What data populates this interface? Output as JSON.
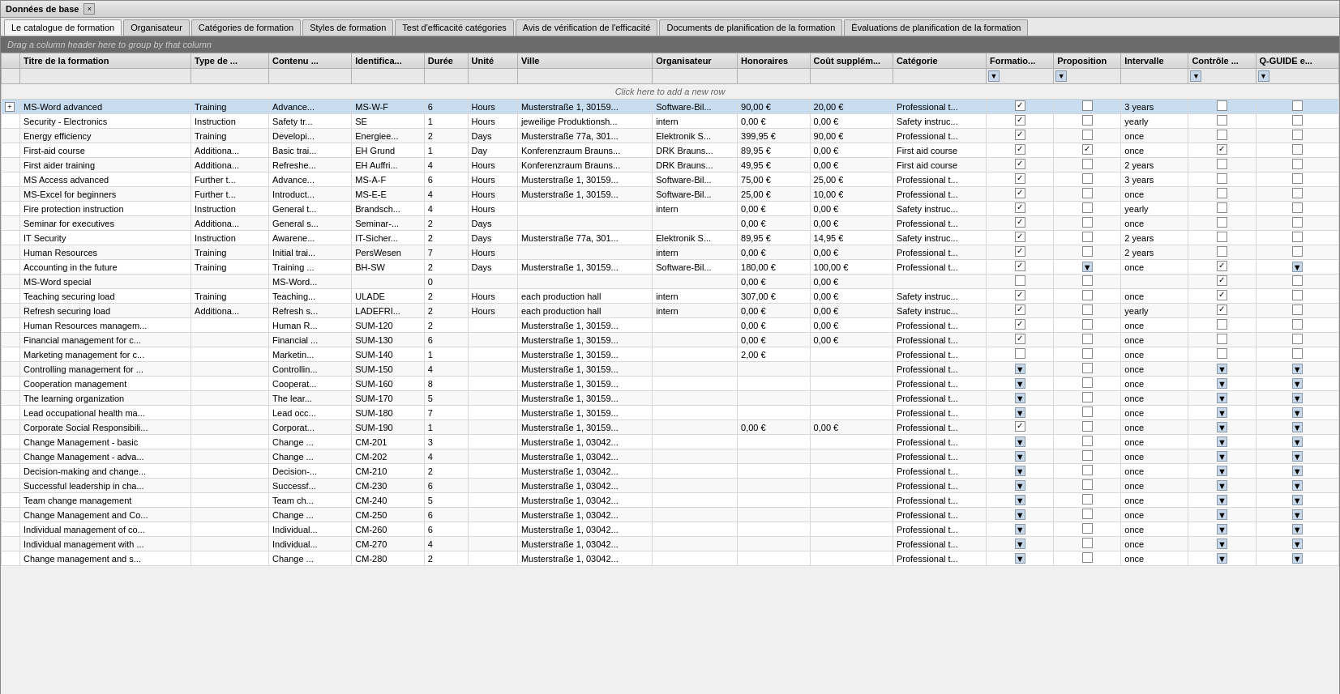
{
  "window": {
    "title": "Données de base",
    "close_label": "×"
  },
  "tabs": [
    {
      "id": "catalogue",
      "label": "Le catalogue de formation",
      "active": true
    },
    {
      "id": "organisateur",
      "label": "Organisateur",
      "active": false
    },
    {
      "id": "categories",
      "label": "Catégories de formation",
      "active": false
    },
    {
      "id": "styles",
      "label": "Styles de formation",
      "active": false
    },
    {
      "id": "test_eff",
      "label": "Test d'efficacité catégories",
      "active": false
    },
    {
      "id": "avis",
      "label": "Avis de vérification de l'efficacité",
      "active": false
    },
    {
      "id": "docs",
      "label": "Documents de planification de la formation",
      "active": false
    },
    {
      "id": "evaluations",
      "label": "Évaluations de planification de la formation",
      "active": false
    }
  ],
  "drag_hint": "Drag a column header here to group by that column",
  "columns": [
    {
      "id": "expand",
      "label": "",
      "width": 18
    },
    {
      "id": "titre",
      "label": "Titre de la formation",
      "width": 165
    },
    {
      "id": "type",
      "label": "Type de ...",
      "width": 75
    },
    {
      "id": "contenu",
      "label": "Contenu ...",
      "width": 80
    },
    {
      "id": "identif",
      "label": "Identifica...",
      "width": 70
    },
    {
      "id": "duree",
      "label": "Durée",
      "width": 42
    },
    {
      "id": "unite",
      "label": "Unité",
      "width": 48
    },
    {
      "id": "ville",
      "label": "Ville",
      "width": 130
    },
    {
      "id": "orga",
      "label": "Organisateur",
      "width": 82
    },
    {
      "id": "honor",
      "label": "Honoraires",
      "width": 70
    },
    {
      "id": "cout",
      "label": "Coût supplém...",
      "width": 80
    },
    {
      "id": "categ",
      "label": "Catégorie",
      "width": 90
    },
    {
      "id": "format",
      "label": "Formatio...",
      "width": 65
    },
    {
      "id": "prop",
      "label": "Proposition",
      "width": 65
    },
    {
      "id": "interv",
      "label": "Intervalle",
      "width": 65
    },
    {
      "id": "ctrl",
      "label": "Contrôle ...",
      "width": 65
    },
    {
      "id": "qguide",
      "label": "Q-GUIDE e...",
      "width": 80
    }
  ],
  "new_row_hint": "Click here to add a new row",
  "rows": [
    {
      "id": 1,
      "selected": true,
      "expanded": false,
      "titre": "MS-Word advanced",
      "type": "Training",
      "contenu": "Advance...",
      "identif": "MS-W-F",
      "duree": "6",
      "unite": "Hours",
      "ville": "Musterstraße 1, 30159...",
      "orga": "Software-Bil...",
      "honor": "90,00 €",
      "cout": "20,00 €",
      "categ": "Professional t...",
      "format_cb": "checked",
      "format_icon": false,
      "prop_cb": false,
      "prop_icon": true,
      "interv": "3 years",
      "ctrl_cb": false,
      "ctrl_icon": true,
      "qguide_cb": false,
      "qguide_icon": true
    },
    {
      "id": 2,
      "selected": false,
      "expanded": false,
      "titre": "Security - Electronics",
      "type": "Instruction",
      "contenu": "Safety tr...",
      "identif": "SE",
      "duree": "1",
      "unite": "Hours",
      "ville": "jeweilige Produktionsh...",
      "orga": "intern",
      "honor": "0,00 €",
      "cout": "0,00 €",
      "categ": "Safety instruc...",
      "format_cb": "checked",
      "prop_cb": false,
      "interv": "yearly",
      "ctrl_cb": false,
      "qguide_cb": false
    },
    {
      "id": 3,
      "selected": false,
      "expanded": false,
      "titre": "Energy efficiency",
      "type": "Training",
      "contenu": "Developi...",
      "identif": "Energiee...",
      "duree": "2",
      "unite": "Days",
      "ville": "Musterstraße 77a, 301...",
      "orga": "Elektronik S...",
      "honor": "399,95 €",
      "cout": "90,00 €",
      "categ": "Professional t...",
      "format_cb": "checked",
      "prop_cb": false,
      "interv": "once",
      "ctrl_cb": false,
      "qguide_cb": false
    },
    {
      "id": 4,
      "selected": false,
      "expanded": false,
      "titre": "First-aid course",
      "type": "Additiona...",
      "contenu": "Basic trai...",
      "identif": "EH Grund",
      "duree": "1",
      "unite": "Day",
      "ville": "Konferenzraum Brauns...",
      "orga": "DRK Brauns...",
      "honor": "89,95 €",
      "cout": "0,00 €",
      "categ": "First aid course",
      "format_cb": "checked",
      "prop_cb": "checked",
      "interv": "once",
      "ctrl_cb": "checked",
      "qguide_cb": false
    },
    {
      "id": 5,
      "selected": false,
      "expanded": false,
      "titre": "First aider training",
      "type": "Additiona...",
      "contenu": "Refreshe...",
      "identif": "EH Auffri...",
      "duree": "4",
      "unite": "Hours",
      "ville": "Konferenzraum Brauns...",
      "orga": "DRK Brauns...",
      "honor": "49,95 €",
      "cout": "0,00 €",
      "categ": "First aid course",
      "format_cb": "checked",
      "prop_cb": false,
      "interv": "2 years",
      "ctrl_cb": false,
      "qguide_cb": false
    },
    {
      "id": 6,
      "selected": false,
      "expanded": false,
      "titre": "MS Access advanced",
      "type": "Further t...",
      "contenu": "Advance...",
      "identif": "MS-A-F",
      "duree": "6",
      "unite": "Hours",
      "ville": "Musterstraße 1, 30159...",
      "orga": "Software-Bil...",
      "honor": "75,00 €",
      "cout": "25,00 €",
      "categ": "Professional t...",
      "format_cb": "checked",
      "prop_cb": false,
      "interv": "3 years",
      "ctrl_cb": false,
      "qguide_cb": false
    },
    {
      "id": 7,
      "selected": false,
      "expanded": false,
      "titre": "MS-Excel for beginners",
      "type": "Further t...",
      "contenu": "Introduct...",
      "identif": "MS-E-E",
      "duree": "4",
      "unite": "Hours",
      "ville": "Musterstraße 1, 30159...",
      "orga": "Software-Bil...",
      "honor": "25,00 €",
      "cout": "10,00 €",
      "categ": "Professional t...",
      "format_cb": "checked",
      "prop_cb": false,
      "interv": "once",
      "ctrl_cb": false,
      "qguide_cb": false
    },
    {
      "id": 8,
      "selected": false,
      "expanded": false,
      "titre": "Fire protection instruction",
      "type": "Instruction",
      "contenu": "General t...",
      "identif": "Brandsch...",
      "duree": "4",
      "unite": "Hours",
      "ville": "",
      "orga": "intern",
      "honor": "0,00 €",
      "cout": "0,00 €",
      "categ": "Safety instruc...",
      "format_cb": "checked",
      "prop_cb": false,
      "interv": "yearly",
      "ctrl_cb": false,
      "qguide_cb": false
    },
    {
      "id": 9,
      "selected": false,
      "expanded": false,
      "titre": "Seminar for executives",
      "type": "Additiona...",
      "contenu": "General s...",
      "identif": "Seminar-...",
      "duree": "2",
      "unite": "Days",
      "ville": "",
      "orga": "",
      "honor": "0,00 €",
      "cout": "0,00 €",
      "categ": "Professional t...",
      "format_cb": "checked",
      "prop_cb": false,
      "interv": "once",
      "ctrl_cb": false,
      "qguide_cb": false
    },
    {
      "id": 10,
      "selected": false,
      "expanded": false,
      "titre": "IT Security",
      "type": "Instruction",
      "contenu": "Awarene...",
      "identif": "IT-Sicher...",
      "duree": "2",
      "unite": "Days",
      "ville": "Musterstraße 77a, 301...",
      "orga": "Elektronik S...",
      "honor": "89,95 €",
      "cout": "14,95 €",
      "categ": "Safety instruc...",
      "format_cb": "checked",
      "prop_cb": false,
      "interv": "2 years",
      "ctrl_cb": false,
      "qguide_cb": false
    },
    {
      "id": 11,
      "selected": false,
      "expanded": false,
      "titre": "Human Resources",
      "type": "Training",
      "contenu": "Initial trai...",
      "identif": "PersWesen",
      "duree": "7",
      "unite": "Hours",
      "ville": "",
      "orga": "intern",
      "honor": "0,00 €",
      "cout": "0,00 €",
      "categ": "Professional t...",
      "format_cb": "checked",
      "prop_cb": false,
      "interv": "2 years",
      "ctrl_cb": false,
      "qguide_cb": false
    },
    {
      "id": 12,
      "selected": false,
      "expanded": false,
      "titre": "Accounting in the future",
      "type": "Training",
      "contenu": "Training ...",
      "identif": "BH-SW",
      "duree": "2",
      "unite": "Days",
      "ville": "Musterstraße 1, 30159...",
      "orga": "Software-Bil...",
      "honor": "180,00 €",
      "cout": "100,00 €",
      "categ": "Professional t...",
      "format_cb": "checked",
      "prop_cb": "icon",
      "interv": "once",
      "ctrl_cb": "checked",
      "qguide_cb": "icon"
    },
    {
      "id": 13,
      "selected": false,
      "expanded": false,
      "titre": "MS-Word special",
      "type": "",
      "contenu": "MS-Word...",
      "identif": "",
      "duree": "0",
      "unite": "",
      "ville": "",
      "orga": "",
      "honor": "0,00 €",
      "cout": "0,00 €",
      "categ": "",
      "format_cb": false,
      "prop_cb": false,
      "interv": "",
      "ctrl_cb": "checked",
      "qguide_cb": false
    },
    {
      "id": 14,
      "selected": false,
      "expanded": false,
      "titre": "Teaching securing load",
      "type": "Training",
      "contenu": "Teaching...",
      "identif": "ULADE",
      "duree": "2",
      "unite": "Hours",
      "ville": "each production hall",
      "orga": "intern",
      "honor": "307,00 €",
      "cout": "0,00 €",
      "categ": "Safety instruc...",
      "format_cb": "checked",
      "prop_cb": false,
      "interv": "once",
      "ctrl_cb": "checked",
      "qguide_cb": false
    },
    {
      "id": 15,
      "selected": false,
      "expanded": false,
      "titre": "Refresh securing load",
      "type": "Additiona...",
      "contenu": "Refresh s...",
      "identif": "LADEFRI...",
      "duree": "2",
      "unite": "Hours",
      "ville": "each production hall",
      "orga": "intern",
      "honor": "0,00 €",
      "cout": "0,00 €",
      "categ": "Safety instruc...",
      "format_cb": "checked",
      "prop_cb": false,
      "interv": "yearly",
      "ctrl_cb": "checked",
      "qguide_cb": false
    },
    {
      "id": 16,
      "selected": false,
      "expanded": false,
      "titre": "Human Resources managem...",
      "type": "",
      "contenu": "Human R...",
      "identif": "SUM-120",
      "duree": "2",
      "unite": "",
      "ville": "Musterstraße 1, 30159...",
      "orga": "",
      "honor": "0,00 €",
      "cout": "0,00 €",
      "categ": "Professional t...",
      "format_cb": "checked",
      "prop_cb": false,
      "interv": "once",
      "ctrl_cb": false,
      "qguide_cb": false
    },
    {
      "id": 17,
      "selected": false,
      "expanded": false,
      "titre": "Financial management for c...",
      "type": "",
      "contenu": "Financial ...",
      "identif": "SUM-130",
      "duree": "6",
      "unite": "",
      "ville": "Musterstraße 1, 30159...",
      "orga": "",
      "honor": "0,00 €",
      "cout": "0,00 €",
      "categ": "Professional t...",
      "format_cb": "checked",
      "prop_cb": false,
      "interv": "once",
      "ctrl_cb": false,
      "qguide_cb": false
    },
    {
      "id": 18,
      "selected": false,
      "expanded": false,
      "titre": "Marketing management for c...",
      "type": "",
      "contenu": "Marketin...",
      "identif": "SUM-140",
      "duree": "1",
      "unite": "",
      "ville": "Musterstraße 1, 30159...",
      "orga": "",
      "honor": "2,00 €",
      "cout": "",
      "categ": "Professional t...",
      "format_cb": false,
      "prop_cb": false,
      "interv": "once",
      "ctrl_cb": false,
      "qguide_cb": false
    },
    {
      "id": 19,
      "selected": false,
      "expanded": false,
      "titre": "Controlling management for ...",
      "type": "",
      "contenu": "Controllin...",
      "identif": "SUM-150",
      "duree": "4",
      "unite": "",
      "ville": "Musterstraße 1, 30159...",
      "orga": "",
      "honor": "",
      "cout": "",
      "categ": "Professional t...",
      "format_cb": "icon",
      "prop_cb": false,
      "interv": "once",
      "ctrl_cb": "icon",
      "qguide_cb": "icon"
    },
    {
      "id": 20,
      "selected": false,
      "expanded": false,
      "titre": "Cooperation management",
      "type": "",
      "contenu": "Cooperat...",
      "identif": "SUM-160",
      "duree": "8",
      "unite": "",
      "ville": "Musterstraße 1, 30159...",
      "orga": "",
      "honor": "",
      "cout": "",
      "categ": "Professional t...",
      "format_cb": "icon",
      "prop_cb": false,
      "interv": "once",
      "ctrl_cb": "icon",
      "qguide_cb": "icon"
    },
    {
      "id": 21,
      "selected": false,
      "expanded": false,
      "titre": "The learning organization",
      "type": "",
      "contenu": "The lear...",
      "identif": "SUM-170",
      "duree": "5",
      "unite": "",
      "ville": "Musterstraße 1, 30159...",
      "orga": "",
      "honor": "",
      "cout": "",
      "categ": "Professional t...",
      "format_cb": "icon",
      "prop_cb": false,
      "interv": "once",
      "ctrl_cb": "icon",
      "qguide_cb": "icon"
    },
    {
      "id": 22,
      "selected": false,
      "expanded": false,
      "titre": "Lead occupational health ma...",
      "type": "",
      "contenu": "Lead occ...",
      "identif": "SUM-180",
      "duree": "7",
      "unite": "",
      "ville": "Musterstraße 1, 30159...",
      "orga": "",
      "honor": "",
      "cout": "",
      "categ": "Professional t...",
      "format_cb": "icon",
      "prop_cb": false,
      "interv": "once",
      "ctrl_cb": "icon",
      "qguide_cb": "icon"
    },
    {
      "id": 23,
      "selected": false,
      "expanded": false,
      "titre": "Corporate Social Responsibili...",
      "type": "",
      "contenu": "Corporat...",
      "identif": "SUM-190",
      "duree": "1",
      "unite": "",
      "ville": "Musterstraße 1, 30159...",
      "orga": "",
      "honor": "0,00 €",
      "cout": "0,00 €",
      "categ": "Professional t...",
      "format_cb": "checked",
      "prop_cb": false,
      "interv": "once",
      "ctrl_cb": "icon",
      "qguide_cb": "icon"
    },
    {
      "id": 24,
      "selected": false,
      "expanded": false,
      "titre": "Change Management - basic",
      "type": "",
      "contenu": "Change ...",
      "identif": "CM-201",
      "duree": "3",
      "unite": "",
      "ville": "Musterstraße 1, 03042...",
      "orga": "",
      "honor": "",
      "cout": "",
      "categ": "Professional t...",
      "format_cb": "icon",
      "prop_cb": false,
      "interv": "once",
      "ctrl_cb": "icon",
      "qguide_cb": "icon"
    },
    {
      "id": 25,
      "selected": false,
      "expanded": false,
      "titre": "Change Management - adva...",
      "type": "",
      "contenu": "Change ...",
      "identif": "CM-202",
      "duree": "4",
      "unite": "",
      "ville": "Musterstraße 1, 03042...",
      "orga": "",
      "honor": "",
      "cout": "",
      "categ": "Professional t...",
      "format_cb": "icon",
      "prop_cb": false,
      "interv": "once",
      "ctrl_cb": "icon",
      "qguide_cb": "icon"
    },
    {
      "id": 26,
      "selected": false,
      "expanded": false,
      "titre": "Decision-making and change...",
      "type": "",
      "contenu": "Decision-...",
      "identif": "CM-210",
      "duree": "2",
      "unite": "",
      "ville": "Musterstraße 1, 03042...",
      "orga": "",
      "honor": "",
      "cout": "",
      "categ": "Professional t...",
      "format_cb": "icon",
      "prop_cb": false,
      "interv": "once",
      "ctrl_cb": "icon",
      "qguide_cb": "icon"
    },
    {
      "id": 27,
      "selected": false,
      "expanded": false,
      "titre": "Successful leadership in cha...",
      "type": "",
      "contenu": "Successf...",
      "identif": "CM-230",
      "duree": "6",
      "unite": "",
      "ville": "Musterstraße 1, 03042...",
      "orga": "",
      "honor": "",
      "cout": "",
      "categ": "Professional t...",
      "format_cb": "icon",
      "prop_cb": false,
      "interv": "once",
      "ctrl_cb": "icon",
      "qguide_cb": "icon"
    },
    {
      "id": 28,
      "selected": false,
      "expanded": false,
      "titre": "Team change management",
      "type": "",
      "contenu": "Team ch...",
      "identif": "CM-240",
      "duree": "5",
      "unite": "",
      "ville": "Musterstraße 1, 03042...",
      "orga": "",
      "honor": "",
      "cout": "",
      "categ": "Professional t...",
      "format_cb": "icon",
      "prop_cb": false,
      "interv": "once",
      "ctrl_cb": "icon",
      "qguide_cb": "icon"
    },
    {
      "id": 29,
      "selected": false,
      "expanded": false,
      "titre": "Change Management and Co...",
      "type": "",
      "contenu": "Change ...",
      "identif": "CM-250",
      "duree": "6",
      "unite": "",
      "ville": "Musterstraße 1, 03042...",
      "orga": "",
      "honor": "",
      "cout": "",
      "categ": "Professional t...",
      "format_cb": "icon",
      "prop_cb": false,
      "interv": "once",
      "ctrl_cb": "icon",
      "qguide_cb": "icon"
    },
    {
      "id": 30,
      "selected": false,
      "expanded": false,
      "titre": "Individual management of co...",
      "type": "",
      "contenu": "Individual...",
      "identif": "CM-260",
      "duree": "6",
      "unite": "",
      "ville": "Musterstraße 1, 03042...",
      "orga": "",
      "honor": "",
      "cout": "",
      "categ": "Professional t...",
      "format_cb": "icon",
      "prop_cb": false,
      "interv": "once",
      "ctrl_cb": "icon",
      "qguide_cb": "icon"
    },
    {
      "id": 31,
      "selected": false,
      "expanded": false,
      "titre": "Individual management with ...",
      "type": "",
      "contenu": "Individual...",
      "identif": "CM-270",
      "duree": "4",
      "unite": "",
      "ville": "Musterstraße 1, 03042...",
      "orga": "",
      "honor": "",
      "cout": "",
      "categ": "Professional t...",
      "format_cb": "icon",
      "prop_cb": false,
      "interv": "once",
      "ctrl_cb": "icon",
      "qguide_cb": "icon"
    },
    {
      "id": 32,
      "selected": false,
      "expanded": false,
      "titre": "Change management and s...",
      "type": "",
      "contenu": "Change ...",
      "identif": "CM-280",
      "duree": "2",
      "unite": "",
      "ville": "Musterstraße 1, 03042...",
      "orga": "",
      "honor": "",
      "cout": "",
      "categ": "Professional t...",
      "format_cb": "icon",
      "prop_cb": false,
      "interv": "once",
      "ctrl_cb": "icon",
      "qguide_cb": "icon"
    }
  ]
}
